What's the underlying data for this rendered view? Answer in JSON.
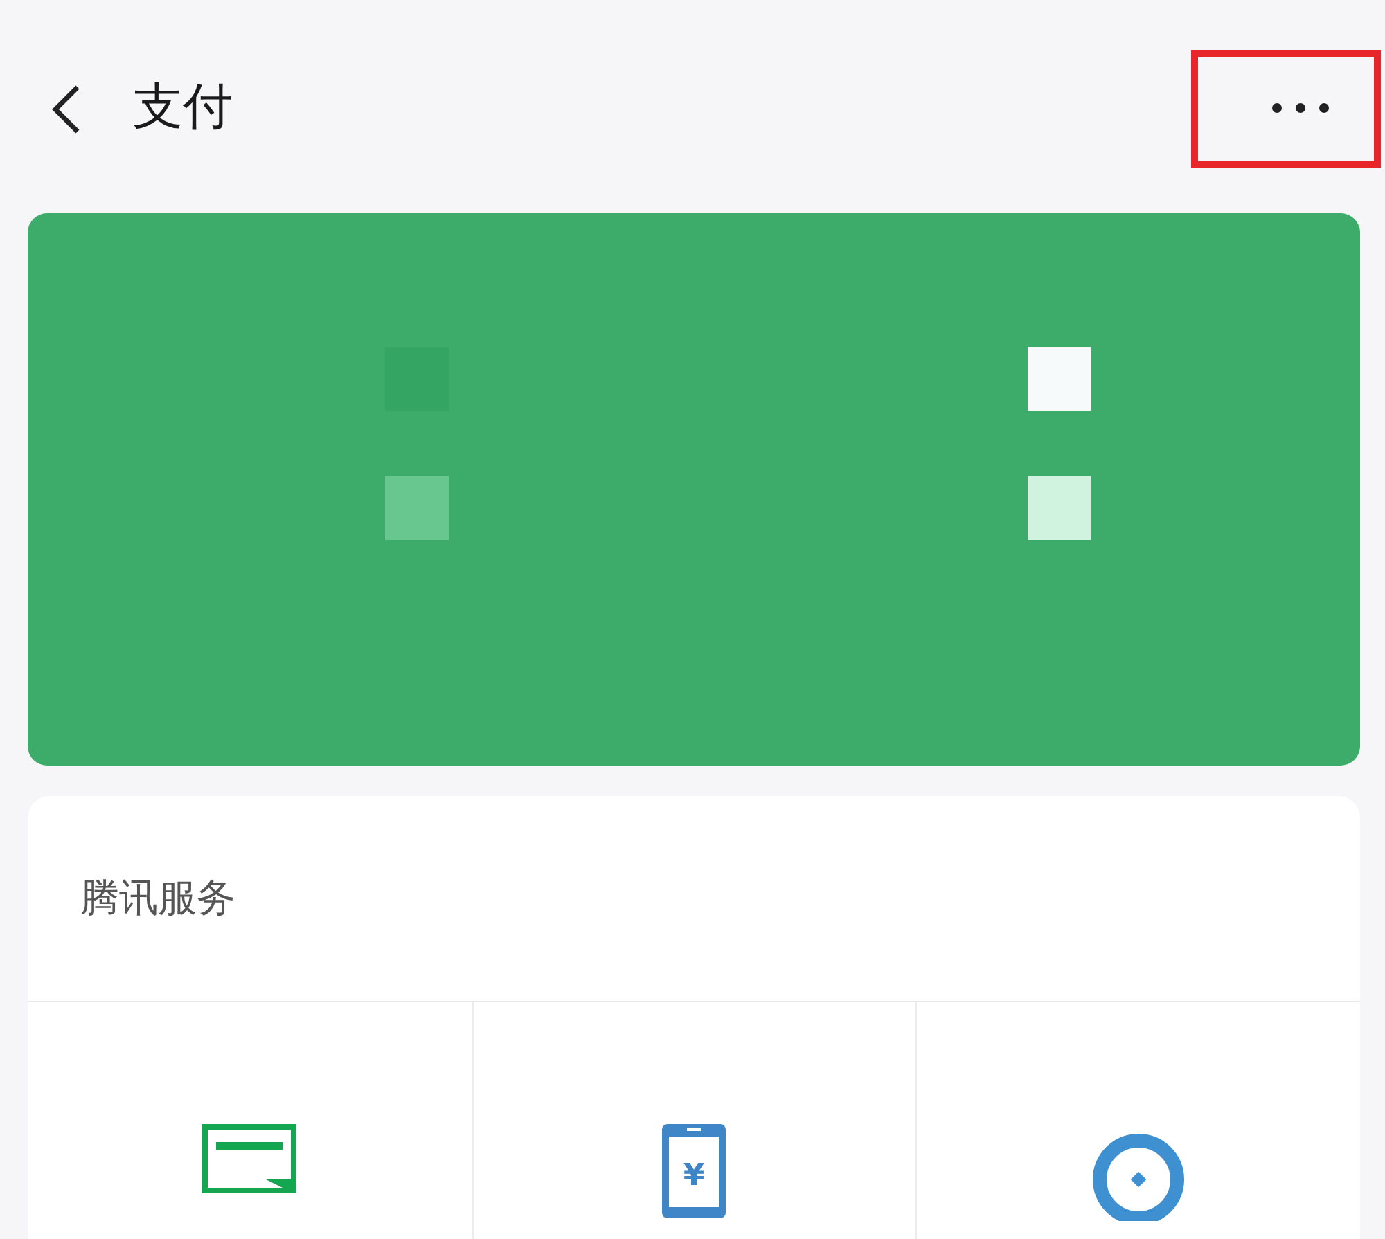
{
  "header": {
    "title": "支付",
    "highlighted_more": true
  },
  "card": {
    "redacted": true
  },
  "services": {
    "title": "腾讯服务",
    "items": [
      {
        "kind": "card"
      },
      {
        "kind": "phone",
        "symbol": "¥"
      },
      {
        "kind": "coin"
      }
    ]
  }
}
